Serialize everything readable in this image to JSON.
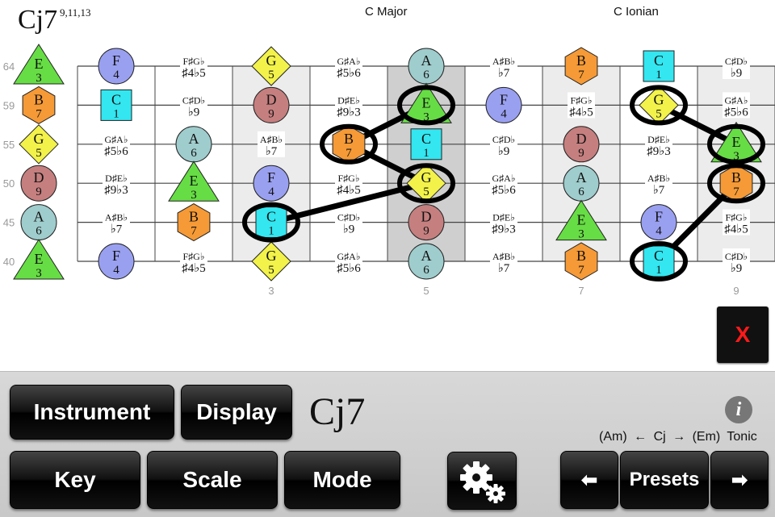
{
  "header": {
    "chord_symbol": "Cj7",
    "chord_extensions": "9,11,13",
    "scale_label": "C Major",
    "mode_label": "C Ionian"
  },
  "fretboard": {
    "string_labels": [
      "64",
      "59",
      "55",
      "50",
      "45",
      "40"
    ],
    "fret_markers": [
      {
        "fret": 3,
        "label": "3"
      },
      {
        "fret": 5,
        "label": "5"
      },
      {
        "fret": 7,
        "label": "7"
      },
      {
        "fret": 9,
        "label": "9"
      }
    ],
    "shaded_frets": [
      3,
      5,
      7,
      9
    ],
    "note_colors": {
      "C": "#33e6f0",
      "D": "#c57f7f",
      "E": "#66dd44",
      "F": "#9aa0f0",
      "G": "#f2f24a",
      "A": "#9fcccc",
      "B": "#f59a36"
    },
    "grid": [
      [
        {
          "n": "E",
          "d": "3"
        },
        {
          "n": "F",
          "d": "4"
        },
        {
          "t": "F♯G♭",
          "b": "♯4♭5"
        },
        {
          "n": "G",
          "d": "5"
        },
        {
          "t": "G♯A♭",
          "b": "♯5♭6"
        },
        {
          "n": "A",
          "d": "6"
        },
        {
          "t": "A♯B♭",
          "b": "♭7"
        },
        {
          "n": "B",
          "d": "7"
        },
        {
          "n": "C",
          "d": "1"
        },
        {
          "t": "C♯D♭",
          "b": "♭9"
        }
      ],
      [
        {
          "n": "B",
          "d": "7"
        },
        {
          "n": "C",
          "d": "1"
        },
        {
          "t": "C♯D♭",
          "b": "♭9"
        },
        {
          "n": "D",
          "d": "9"
        },
        {
          "t": "D♯E♭",
          "b": "♯9♭3"
        },
        {
          "n": "E",
          "d": "3"
        },
        {
          "n": "F",
          "d": "4"
        },
        {
          "t": "F♯G♭",
          "b": "♯4♭5"
        },
        {
          "n": "G",
          "d": "5"
        },
        {
          "t": "G♯A♭",
          "b": "♯5♭6"
        }
      ],
      [
        {
          "n": "G",
          "d": "5"
        },
        {
          "t": "G♯A♭",
          "b": "♯5♭6"
        },
        {
          "n": "A",
          "d": "6"
        },
        {
          "t": "A♯B♭",
          "b": "♭7"
        },
        {
          "n": "B",
          "d": "7"
        },
        {
          "n": "C",
          "d": "1"
        },
        {
          "t": "C♯D♭",
          "b": "♭9"
        },
        {
          "n": "D",
          "d": "9"
        },
        {
          "t": "D♯E♭",
          "b": "♯9♭3"
        },
        {
          "n": "E",
          "d": "3"
        }
      ],
      [
        {
          "n": "D",
          "d": "9"
        },
        {
          "t": "D♯E♭",
          "b": "♯9♭3"
        },
        {
          "n": "E",
          "d": "3"
        },
        {
          "n": "F",
          "d": "4"
        },
        {
          "t": "F♯G♭",
          "b": "♯4♭5"
        },
        {
          "n": "G",
          "d": "5"
        },
        {
          "t": "G♯A♭",
          "b": "♯5♭6"
        },
        {
          "n": "A",
          "d": "6"
        },
        {
          "t": "A♯B♭",
          "b": "♭7"
        },
        {
          "n": "B",
          "d": "7"
        }
      ],
      [
        {
          "n": "A",
          "d": "6"
        },
        {
          "t": "A♯B♭",
          "b": "♭7"
        },
        {
          "n": "B",
          "d": "7"
        },
        {
          "n": "C",
          "d": "1"
        },
        {
          "t": "C♯D♭",
          "b": "♭9"
        },
        {
          "n": "D",
          "d": "9"
        },
        {
          "t": "D♯E♭",
          "b": "♯9♭3"
        },
        {
          "n": "E",
          "d": "3"
        },
        {
          "n": "F",
          "d": "4"
        },
        {
          "t": "F♯G♭",
          "b": "♯4♭5"
        }
      ],
      [
        {
          "n": "E",
          "d": "3"
        },
        {
          "n": "F",
          "d": "4"
        },
        {
          "t": "F♯G♭",
          "b": "♯4♭5"
        },
        {
          "n": "G",
          "d": "5"
        },
        {
          "t": "G♯A♭",
          "b": "♯5♭6"
        },
        {
          "n": "A",
          "d": "6"
        },
        {
          "t": "A♯B♭",
          "b": "♭7"
        },
        {
          "n": "B",
          "d": "7"
        },
        {
          "n": "C",
          "d": "1"
        },
        {
          "t": "C♯D♭",
          "b": "♭9"
        }
      ]
    ],
    "chord_groups": [
      [
        [
          4,
          3
        ],
        [
          3,
          5
        ],
        [
          2,
          4
        ],
        [
          1,
          5
        ]
      ],
      [
        [
          5,
          8
        ],
        [
          3,
          9
        ],
        [
          2,
          9
        ],
        [
          1,
          8
        ]
      ]
    ]
  },
  "close_button": {
    "label": "X"
  },
  "controls": {
    "instrument_label": "Instrument",
    "display_label": "Display",
    "key_label": "Key",
    "scale_label": "Scale",
    "mode_label": "Mode",
    "presets_label": "Presets",
    "chord_display": "Cj7",
    "info_label": "i",
    "nav_prev": "(Am)",
    "nav_left_arrow": "←",
    "nav_current": "Cj",
    "nav_right_arrow": "→",
    "nav_next": "(Em)",
    "nav_role": "Tonic",
    "prev_arrow": "⬅",
    "next_arrow": "➡"
  }
}
